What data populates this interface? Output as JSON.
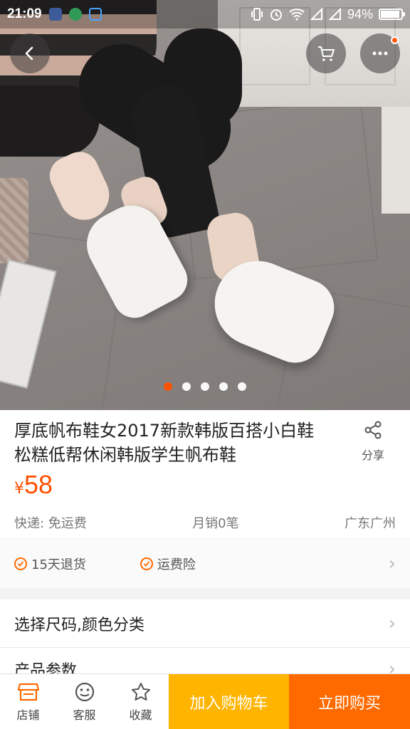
{
  "status_bar": {
    "time": "21:09",
    "battery": "94%",
    "battery_level": 0.94
  },
  "product": {
    "title_line1": "厚底帆布鞋女2017新款韩版百搭小白鞋",
    "title_line2": "松糕低帮休闲韩版学生帆布鞋",
    "currency": "¥",
    "price": "58",
    "shipping": "快递: 免运费",
    "monthly_sales": "月销0笔",
    "location": "广东广州",
    "image_count": 5,
    "current_image": 1
  },
  "share_label": "分享",
  "services": [
    "15天退货",
    "运费险"
  ],
  "options_row": "选择尺码,颜色分类",
  "params_row": "产品参数",
  "bottom_bar": {
    "shop": "店铺",
    "service": "客服",
    "favorite": "收藏",
    "add_to_cart": "加入购物车",
    "buy_now": "立即购买"
  },
  "colors": {
    "accent": "#ff5000",
    "cart_button": "#ffb400",
    "buy_button": "#ff6a00"
  }
}
